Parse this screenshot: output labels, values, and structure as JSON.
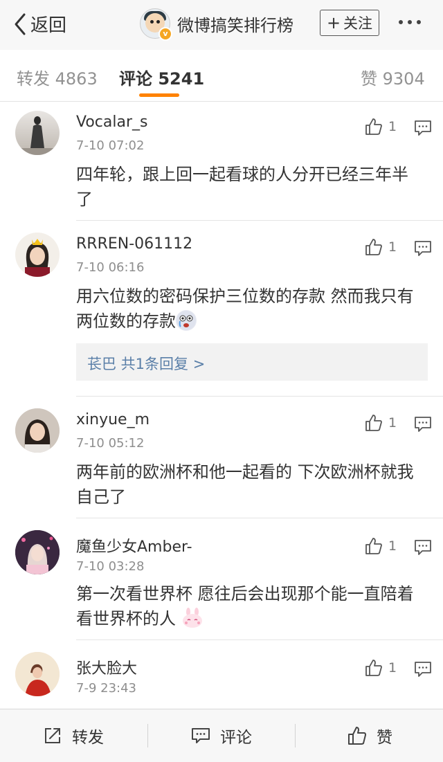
{
  "header": {
    "back_label": "返回",
    "title": "微博搞笑排行榜",
    "follow_label": "关注"
  },
  "tabs": [
    {
      "label": "转发",
      "count": "4863"
    },
    {
      "label": "评论",
      "count": "5241"
    },
    {
      "label": "赞",
      "count": "9304"
    }
  ],
  "comments": [
    {
      "name": "Vocalar_s",
      "time": "7-10 07:02",
      "text": "四年轮，跟上回一起看球的人分开已经三年半了",
      "likes": "1"
    },
    {
      "name": "RRREN-061112",
      "time": "7-10 06:16",
      "text": "用六位数的密码保护三位数的存款 然而我只有两位数的存款",
      "likes": "1",
      "reply_summary": "苌巴  共1条回复 >"
    },
    {
      "name": "xinyue_m",
      "time": "7-10 05:12",
      "text": "两年前的欧洲杯和他一起看的 下次欧洲杯就我自己了",
      "likes": "1"
    },
    {
      "name": "魔鱼少女Amber-",
      "time": "7-10 03:28",
      "text": "第一次看世界杯 愿往后会出现那个能一直陪着看世界杯的人",
      "likes": "1"
    },
    {
      "name": "张大脸大",
      "time": "7-9 23:43",
      "text": "",
      "likes": "1"
    }
  ],
  "bottom_bar": {
    "repost_label": "转发",
    "comment_label": "评论",
    "like_label": "赞"
  },
  "colors": {
    "accent": "#ff8200",
    "link": "#5a7fa8",
    "verified": "#f5a623"
  },
  "icons": [
    "back-chevron-icon",
    "verified-badge-icon",
    "more-dots-icon",
    "thumbs-up-icon",
    "comment-bubble-icon",
    "share-icon"
  ]
}
